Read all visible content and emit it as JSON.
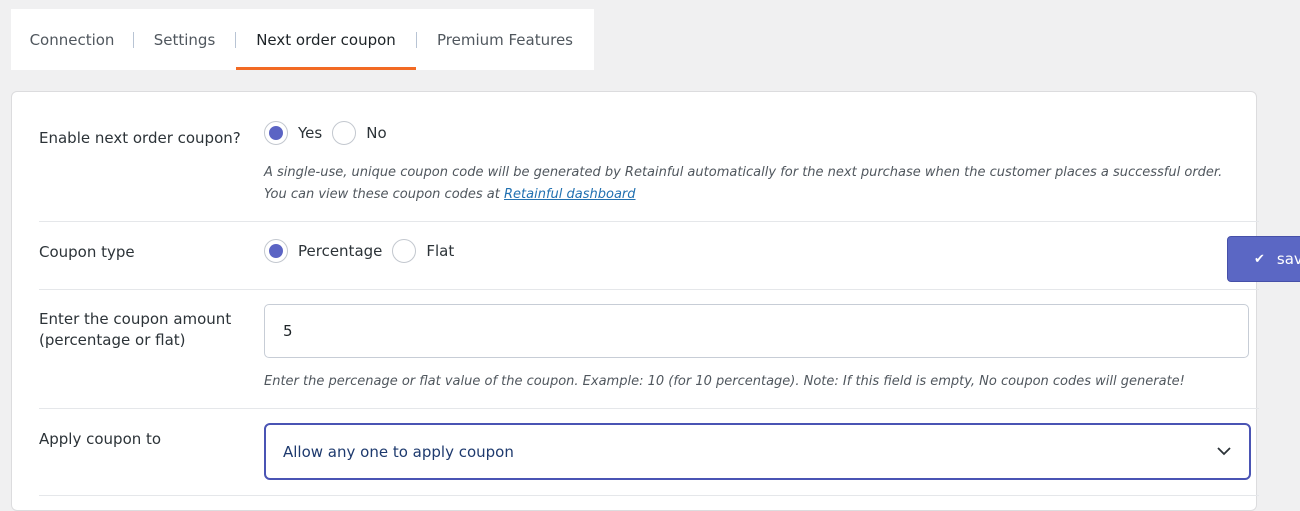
{
  "tabs": [
    {
      "label": "Connection",
      "active": false
    },
    {
      "label": "Settings",
      "active": false
    },
    {
      "label": "Next order coupon",
      "active": true
    },
    {
      "label": "Premium Features",
      "active": false
    }
  ],
  "form": {
    "enable_coupon": {
      "label": "Enable next order coupon?",
      "options": [
        {
          "label": "Yes",
          "checked": true
        },
        {
          "label": "No",
          "checked": false
        }
      ],
      "description": "A single-use, unique coupon code will be generated by Retainful automatically for the next purchase when the customer places a successful order. You can view these coupon codes at ",
      "description_link": "Retainful dashboard"
    },
    "coupon_type": {
      "label": "Coupon type",
      "options": [
        {
          "label": "Percentage",
          "checked": true
        },
        {
          "label": "Flat",
          "checked": false
        }
      ]
    },
    "coupon_amount": {
      "label_line1": "Enter the coupon amount",
      "label_line2": "(percentage or flat)",
      "value": "5",
      "description": "Enter the percenage or flat value of the coupon. Example: 10 (for 10 percentage). Note: If this field is empty, No coupon codes will generate!"
    },
    "apply_coupon_to": {
      "label": "Apply coupon to",
      "selected": "Allow any one to apply coupon"
    }
  },
  "save_button": {
    "icon": "check-icon",
    "label": "save"
  },
  "colors": {
    "accent": "#5b64c4",
    "tab_underline": "#f26a23",
    "link": "#2271b1"
  }
}
